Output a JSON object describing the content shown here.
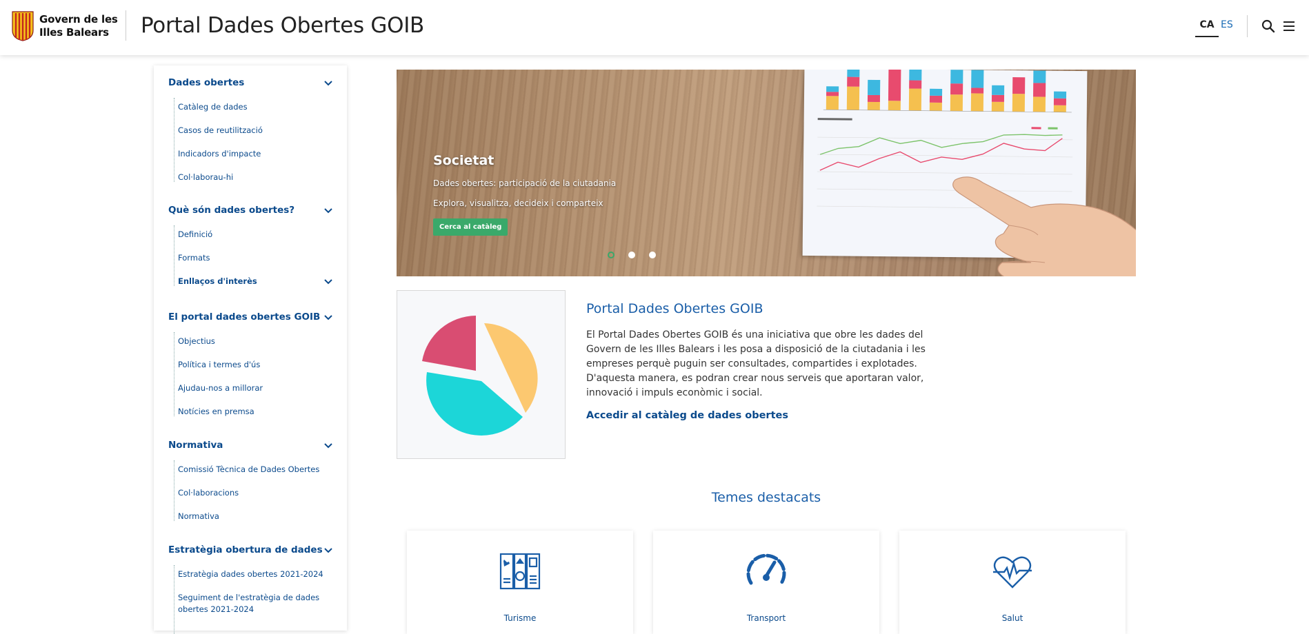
{
  "header": {
    "logo_line1": "Govern de les",
    "logo_line2": "Illes Balears",
    "title": "Portal Dades Obertes GOIB",
    "lang_active": "CA",
    "lang_other": "ES",
    "icons": [
      "search-icon",
      "hamburger-menu-icon"
    ]
  },
  "sidebar": {
    "sections": [
      {
        "title": "Dades obertes",
        "items": [
          "Catàleg de dades",
          "Casos de reutilització",
          "Indicadors d'impacte",
          "Col·laborau-hi"
        ]
      },
      {
        "title": "Què són dades obertes?",
        "items": [
          "Definició",
          "Formats",
          "Enllaços d'interès"
        ]
      },
      {
        "title": "El portal dades obertes GOIB",
        "items": [
          "Objectius",
          "Política i termes d'ús",
          "Ajudau-nos a millorar",
          "Notícies en premsa"
        ]
      },
      {
        "title": "Normativa",
        "items": [
          "Comissió Tècnica de Dades Obertes",
          "Col·laboracions",
          "Normativa"
        ]
      },
      {
        "title": "Estratègia obertura de dades",
        "items": [
          "Estratègia dades obertes 2021-2024",
          "Seguiment de l'estratègia de dades",
          "obertes 2021-2024"
        ]
      }
    ]
  },
  "hero": {
    "title": "Societat",
    "line1": "Dades obertes: participació de la ciutadania",
    "line2": "Explora, visualitza, decideix i comparteix",
    "button": "Cerca al catàleg",
    "slides": 3,
    "active_slide": 1
  },
  "intro": {
    "title": "Portal Dades Obertes GOIB",
    "body": "El Portal Dades Obertes GOIB és una iniciativa que obre les dades del Govern de les Illes Balears i les posa a disposició de la ciutadania i les empreses perquè puguin ser consultades, compartides i explotades. D'aquesta manera, es podran crear nous serveis que aportaran valor, innovació i impuls econòmic i social.",
    "link": "Accedir al catàleg de dades obertes"
  },
  "temes": {
    "title": "Temes destacats",
    "cards": [
      {
        "label": "Turisme",
        "icon": "tourism-brochure-icon"
      },
      {
        "label": "Transport",
        "icon": "speedometer-icon"
      },
      {
        "label": "Salut",
        "icon": "heart-pulse-icon"
      }
    ]
  },
  "colors": {
    "primary": "#0b4a8c",
    "accent": "#1a5ea8",
    "green": "#3aa96a",
    "pie_orange": "#fcc870",
    "pie_cyan": "#1cd6d8",
    "pie_red": "#d94d72"
  }
}
